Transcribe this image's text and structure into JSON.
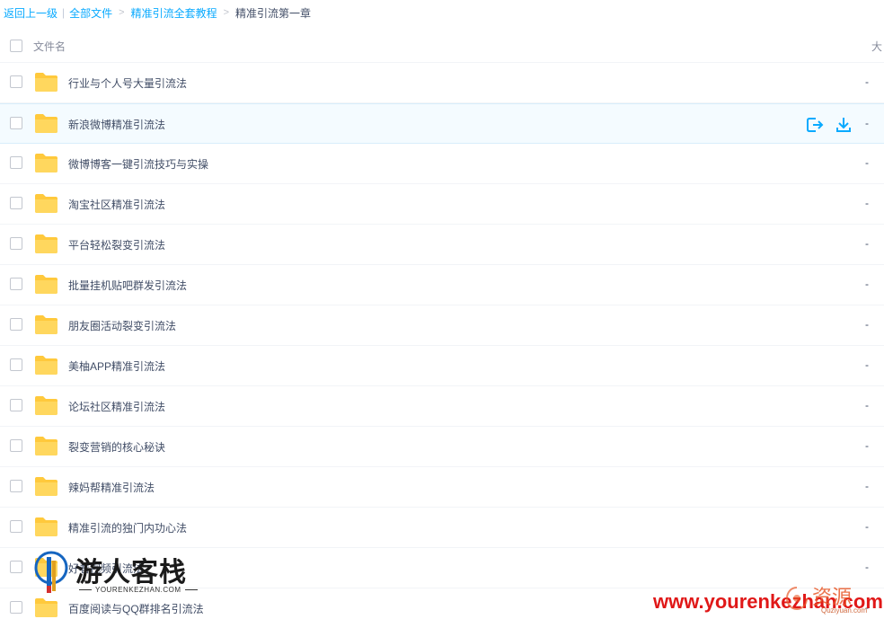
{
  "breadcrumb": {
    "back": "返回上一级",
    "all_files": "全部文件",
    "parent": "精准引流全套教程",
    "current": "精准引流第一章"
  },
  "header": {
    "name_col": "文件名",
    "size_col": "大"
  },
  "rows": [
    {
      "name": "行业与个人号大量引流法",
      "size": "-"
    },
    {
      "name": "新浪微博精准引流法",
      "size": "-",
      "hover": true
    },
    {
      "name": "微博博客一键引流技巧与实操",
      "size": "-"
    },
    {
      "name": "淘宝社区精准引流法",
      "size": "-"
    },
    {
      "name": "平台轻松裂变引流法",
      "size": "-"
    },
    {
      "name": "批量挂机贴吧群发引流法",
      "size": "-"
    },
    {
      "name": "朋友圈活动裂变引流法",
      "size": "-"
    },
    {
      "name": "美柚APP精准引流法",
      "size": "-"
    },
    {
      "name": "论坛社区精准引流法",
      "size": "-"
    },
    {
      "name": "裂变营销的核心秘诀",
      "size": "-"
    },
    {
      "name": "辣妈帮精准引流法",
      "size": "-"
    },
    {
      "name": "精准引流的独门内功心法",
      "size": "-"
    },
    {
      "name": "好看视频引流法",
      "size": "-"
    },
    {
      "name": "百度阅读与QQ群排名引流法",
      "size": "-"
    }
  ],
  "icons": {
    "folder": "folder-icon",
    "share": "share-icon",
    "download": "download-icon"
  },
  "colors": {
    "accent": "#09aaff",
    "folder": "#ffd257",
    "hover_bg": "#f4fbff"
  },
  "watermark": {
    "logo_title": "游人客栈",
    "logo_sub": "YOURENKEZHAN.COM",
    "url": "www.yourenkezhan.com",
    "badge": "资源",
    "badge_sub": "Quziyuan.com"
  }
}
